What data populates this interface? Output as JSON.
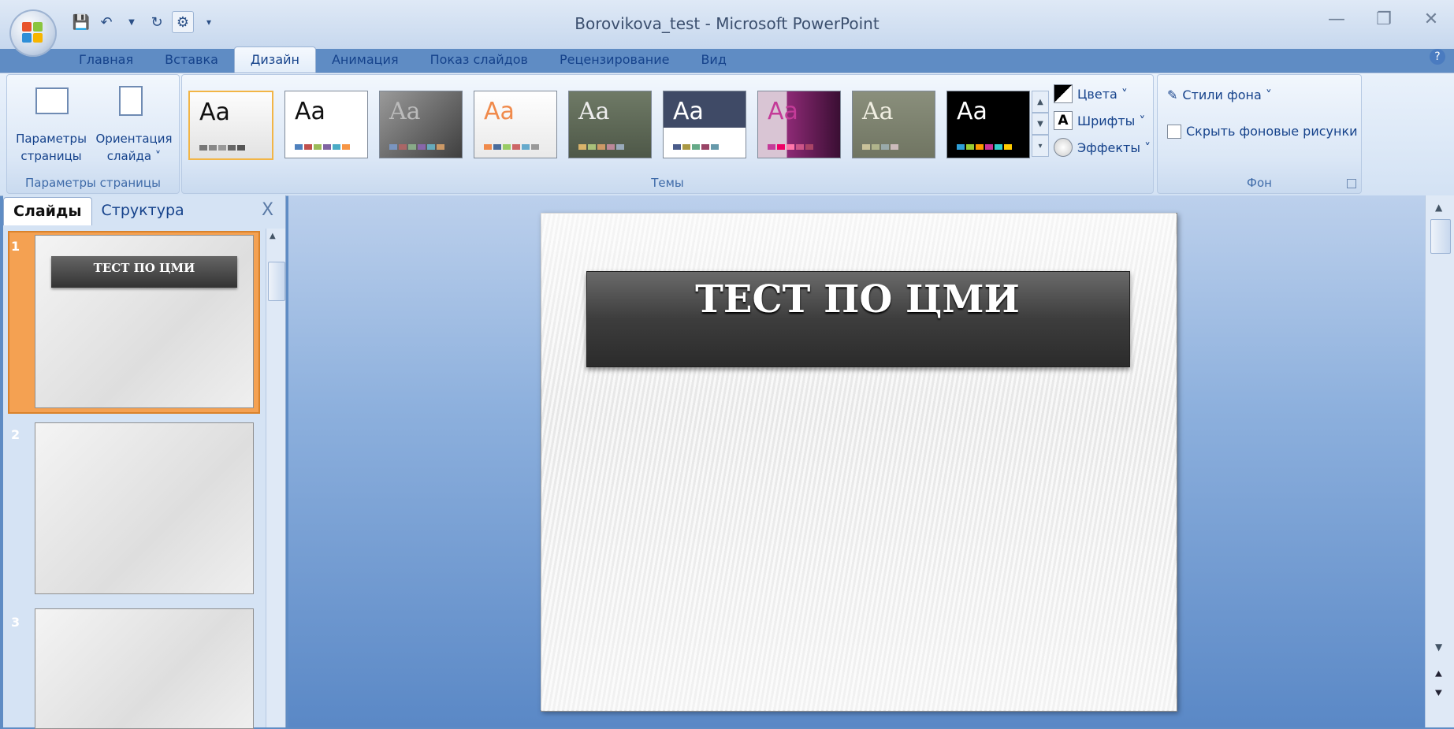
{
  "window": {
    "title": "Borovikova_test - Microsoft PowerPoint"
  },
  "tabs": [
    "Главная",
    "Вставка",
    "Дизайн",
    "Анимация",
    "Показ слайдов",
    "Рецензирование",
    "Вид"
  ],
  "ribbon": {
    "page_setup": {
      "btn1": "Параметры\nстраницы",
      "btn2": "Ориентация\nслайда ˅",
      "label": "Параметры страницы"
    },
    "themes": {
      "label": "Темы",
      "sample": "Aa",
      "side": {
        "colors": "Цвета ˅",
        "fonts": "Шрифты ˅",
        "effects": "Эффекты ˅"
      }
    },
    "background": {
      "styles": "Стили фона ˅",
      "hide": "Скрыть фоновые рисунки",
      "label": "Фон"
    }
  },
  "pane": {
    "tab_slides": "Слайды",
    "tab_outline": "Структура",
    "close": "X",
    "thumbs": [
      {
        "num": "1",
        "title": "ТЕСТ ПО ЦМИ"
      },
      {
        "num": "2",
        "title": ""
      },
      {
        "num": "3",
        "title": ""
      }
    ]
  },
  "slide": {
    "title": "ТЕСТ ПО ЦМИ"
  },
  "colors": {
    "accent_selected": "#f4a152"
  }
}
